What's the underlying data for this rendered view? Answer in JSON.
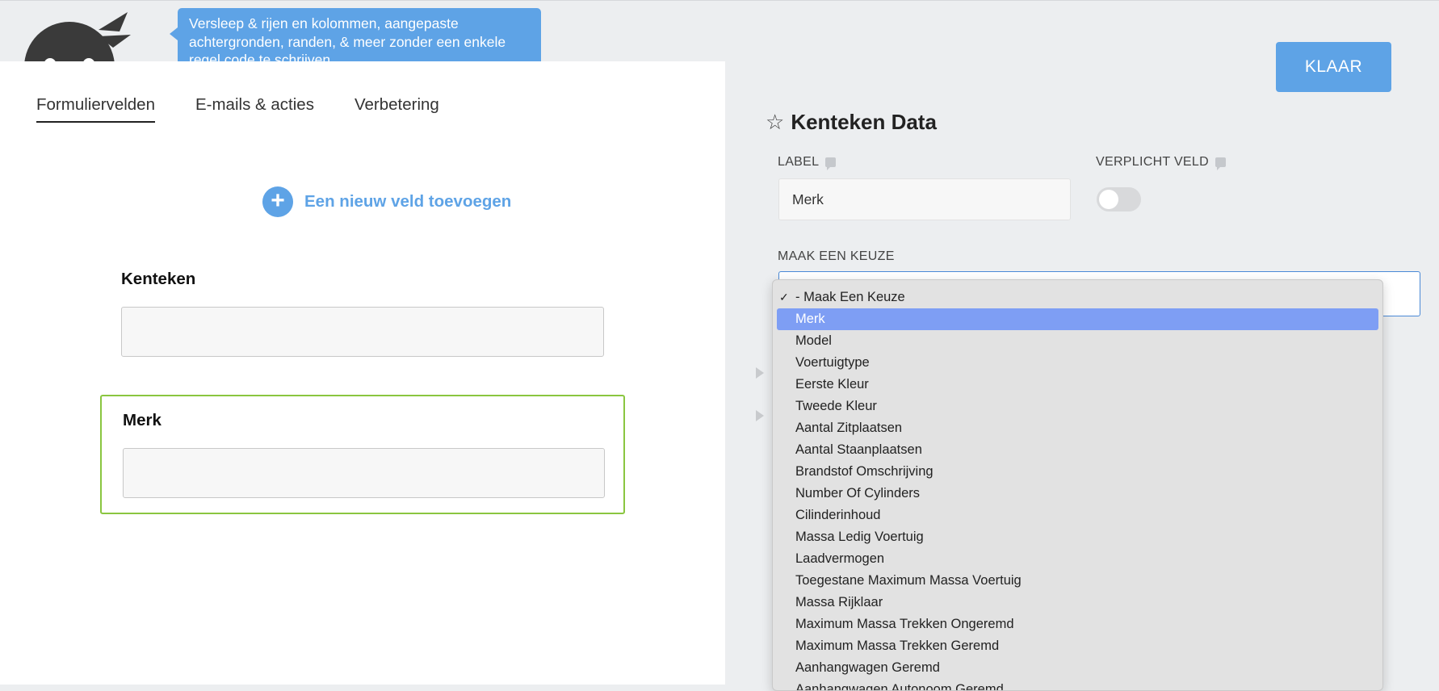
{
  "header": {
    "tooltip": "Versleep & rijen en kolommen, aangepaste achtergronden, randen, & meer zonder een enkele regel code te schrijven.",
    "done_label": "KLAAR"
  },
  "builder": {
    "tabs": [
      {
        "label": "Formuliervelden"
      },
      {
        "label": "E-mails & acties"
      },
      {
        "label": "Verbetering"
      }
    ],
    "add_field_label": "Een nieuw veld toevoegen",
    "fields": [
      {
        "label": "Kenteken",
        "value": ""
      },
      {
        "label": "Merk",
        "value": ""
      }
    ]
  },
  "settings": {
    "title": "Kenteken Data",
    "label_heading": "LABEL",
    "label_value": "Merk",
    "required_heading": "VERPLICHT VELD",
    "required": false,
    "choice_heading": "MAAK EEN KEUZE"
  },
  "dropdown": {
    "selected_index": 0,
    "highlighted_index": 1,
    "options": [
      "- Maak Een Keuze",
      "Merk",
      "Model",
      "Voertuigtype",
      "Eerste Kleur",
      "Tweede Kleur",
      "Aantal Zitplaatsen",
      "Aantal Staanplaatsen",
      "Brandstof Omschrijving",
      "Number Of Cylinders",
      "Cilinderinhoud",
      "Massa Ledig Voertuig",
      "Laadvermogen",
      "Toegestane Maximum Massa Voertuig",
      "Massa Rijklaar",
      "Maximum Massa Trekken Ongeremd",
      "Maximum Massa Trekken Geremd",
      "Aanhangwagen Geremd",
      "Aanhangwagen Autonoom Geremd"
    ]
  },
  "colors": {
    "accent": "#5ea3e6",
    "selected_field_border": "#8ac640",
    "dropdown_highlight": "#7e9ef4"
  }
}
